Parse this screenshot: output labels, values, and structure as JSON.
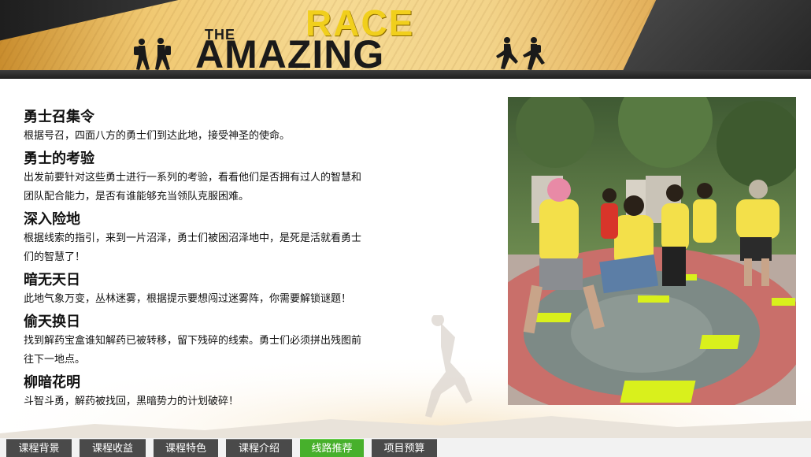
{
  "banner": {
    "logo_the": "THE",
    "logo_race": "RACE",
    "logo_amazing": "AMAZING"
  },
  "sections": [
    {
      "title": "勇士召集令",
      "lines": [
        "根据号召，四面八方的勇士们到达此地，接受神圣的使命。"
      ]
    },
    {
      "title": "勇士的考验",
      "lines": [
        "出发前要针对这些勇士进行一系列的考验，看看他们是否拥有过人的智慧和",
        "团队配合能力，是否有谁能够充当领队克服困难。"
      ]
    },
    {
      "title": "深入险地",
      "lines": [
        "根据线索的指引，来到一片沼泽，勇士们被困沼泽地中，是死是活就看勇士",
        "们的智慧了！"
      ]
    },
    {
      "title": "暗无天日",
      "lines": [
        "此地气象万变，丛林迷雾，根据提示要想闯过迷雾阵，你需要解锁谜题！"
      ]
    },
    {
      "title": "偷天换日",
      "lines": [
        "找到解药宝盒谁知解药已被转移，留下残碎的线索。勇士们必须拼出残图前",
        "往下一地点。"
      ]
    },
    {
      "title": "柳暗花明",
      "lines": [
        "斗智斗勇，解药被找回，黑暗势力的计划破碎！"
      ]
    }
  ],
  "tabs": [
    {
      "label": "课程背景",
      "active": false
    },
    {
      "label": "课程收益",
      "active": false
    },
    {
      "label": "课程特色",
      "active": false
    },
    {
      "label": "课程介绍",
      "active": false
    },
    {
      "label": "线路推荐",
      "active": true
    },
    {
      "label": "项目预算",
      "active": false
    }
  ],
  "colors": {
    "active_tab": "#47b02c",
    "inactive_tab": "#4a4a4a",
    "logo_yellow": "#f1cf1c"
  },
  "icons": [
    "hiker-silhouette-icon",
    "runner-silhouette-icon"
  ]
}
